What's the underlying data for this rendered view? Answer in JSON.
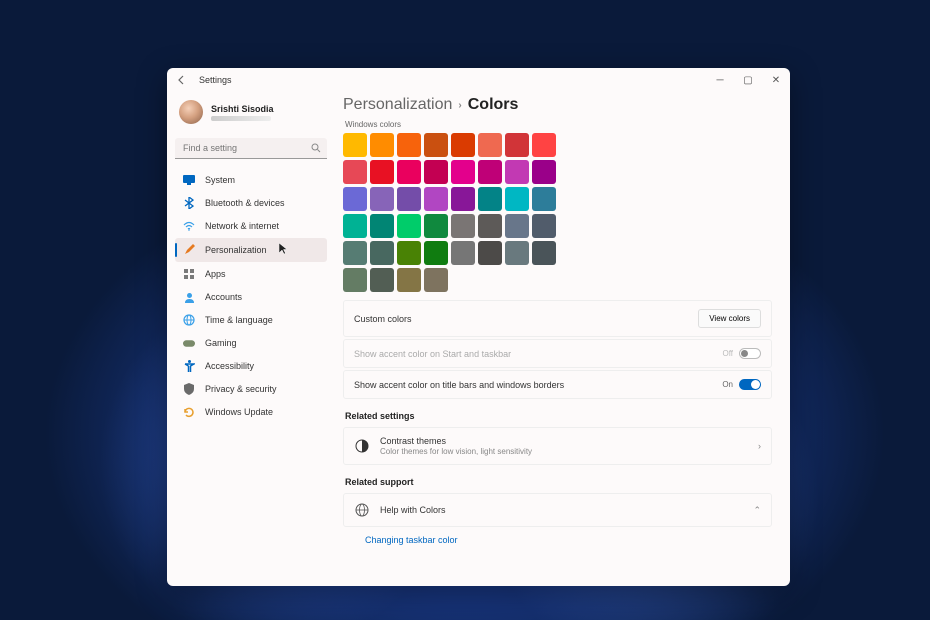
{
  "window": {
    "title": "Settings"
  },
  "profile": {
    "name": "Srishti Sisodia"
  },
  "search": {
    "placeholder": "Find a setting"
  },
  "nav": {
    "items": [
      {
        "label": "System",
        "icon": "system-icon",
        "color": "#0067c0"
      },
      {
        "label": "Bluetooth & devices",
        "icon": "bluetooth-icon",
        "color": "#0067c0"
      },
      {
        "label": "Network & internet",
        "icon": "network-icon",
        "color": "#3aa0e8"
      },
      {
        "label": "Personalization",
        "icon": "paintbrush-icon",
        "color": "#e67a20",
        "selected": true
      },
      {
        "label": "Apps",
        "icon": "apps-icon",
        "color": "#7a7a7a"
      },
      {
        "label": "Accounts",
        "icon": "accounts-icon",
        "color": "#3aa0e8"
      },
      {
        "label": "Time & language",
        "icon": "time-language-icon",
        "color": "#3aa0e8"
      },
      {
        "label": "Gaming",
        "icon": "gaming-icon",
        "color": "#7a8a6a"
      },
      {
        "label": "Accessibility",
        "icon": "accessibility-icon",
        "color": "#0067c0"
      },
      {
        "label": "Privacy & security",
        "icon": "privacy-icon",
        "color": "#6a6a6a"
      },
      {
        "label": "Windows Update",
        "icon": "windows-update-icon",
        "color": "#e8a030"
      }
    ]
  },
  "breadcrumb": {
    "parent": "Personalization",
    "current": "Colors"
  },
  "colors": {
    "section_label": "Windows colors",
    "swatches": [
      "#ffb900",
      "#ff8c00",
      "#f7630c",
      "#ca5010",
      "#da3b01",
      "#ef6950",
      "#d13438",
      "#ff4343",
      "#e74856",
      "#e81123",
      "#ea005e",
      "#c30052",
      "#e3008c",
      "#bf0077",
      "#c239b3",
      "#9a0089",
      "#6b69d6",
      "#8764b8",
      "#744da9",
      "#b146c2",
      "#881798",
      "#038387",
      "#00b7c3",
      "#2d7d9a",
      "#00b294",
      "#018574",
      "#00cc6a",
      "#10893e",
      "#7a7574",
      "#5d5a58",
      "#68768a",
      "#515c6b",
      "#567c73",
      "#486860",
      "#498205",
      "#107c10",
      "#767676",
      "#4c4a48",
      "#69797e",
      "#4a5459",
      "#647c64",
      "#525e54",
      "#847545",
      "#7e735f"
    ]
  },
  "settings": {
    "custom_colors": {
      "label": "Custom colors",
      "button": "View colors"
    },
    "start_taskbar": {
      "label": "Show accent color on Start and taskbar",
      "state_label": "Off",
      "on": false,
      "disabled": true
    },
    "titlebars": {
      "label": "Show accent color on title bars and windows borders",
      "state_label": "On",
      "on": true
    }
  },
  "related": {
    "heading": "Related settings",
    "contrast": {
      "title": "Contrast themes",
      "sub": "Color themes for low vision, light sensitivity"
    }
  },
  "support": {
    "heading": "Related support",
    "help": {
      "title": "Help with Colors"
    },
    "link": "Changing taskbar color"
  }
}
